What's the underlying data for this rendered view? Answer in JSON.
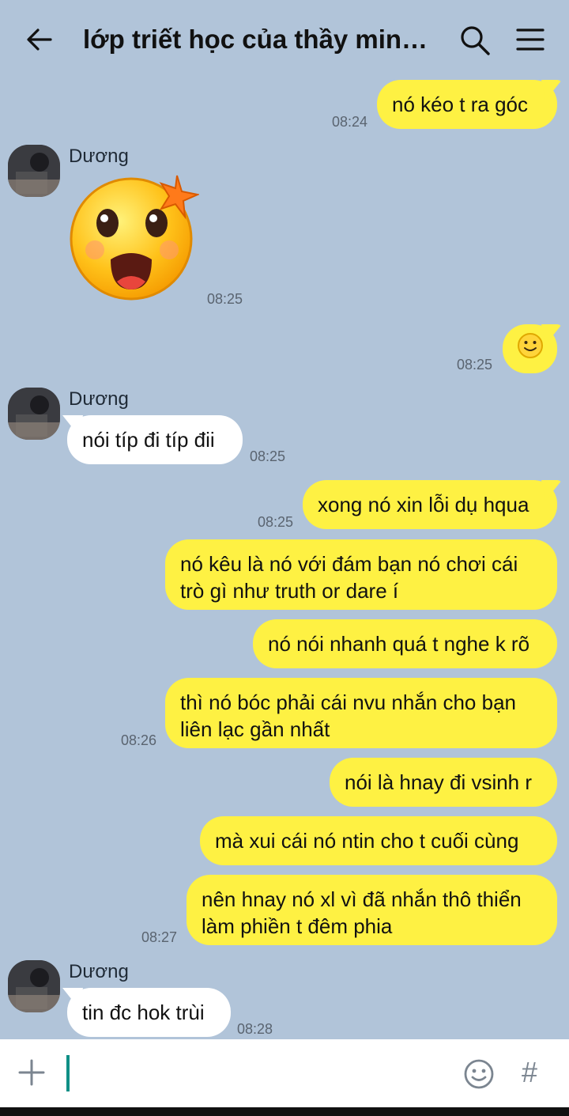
{
  "header": {
    "title": "lớp triết học của thầy min…",
    "back_icon": "back-arrow-icon",
    "search_icon": "search-icon",
    "menu_icon": "hamburger-menu-icon"
  },
  "sender_name": "Dương",
  "messages": [
    {
      "side": "me",
      "text": "nó kéo t ra góc",
      "time": "08:24"
    },
    {
      "side": "them",
      "kind": "sticker",
      "sticker": "surprised-emoji-sticker",
      "time": "08:25"
    },
    {
      "side": "me",
      "kind": "emoji",
      "emoji": "🙂",
      "time": "08:25"
    },
    {
      "side": "them",
      "text": "nói típ đi típ đii",
      "time": "08:25"
    },
    {
      "side": "me",
      "text": "xong nó xin lỗi dụ hqua",
      "time": "08:25"
    },
    {
      "side": "me",
      "text": "nó kêu là nó với đám bạn nó chơi cái trò gì như truth or dare í"
    },
    {
      "side": "me",
      "text": "nó nói nhanh quá t nghe k rõ"
    },
    {
      "side": "me",
      "text": "thì nó bóc phải cái nvu nhắn cho bạn liên lạc gần nhất",
      "time": "08:26"
    },
    {
      "side": "me",
      "text": "nói là hnay đi vsinh r"
    },
    {
      "side": "me",
      "text": "mà xui cái nó ntin cho t cuối cùng"
    },
    {
      "side": "me",
      "text": "nên hnay nó xl vì đã nhắn thô thiển làm phiền t đêm phia",
      "time": "08:27"
    },
    {
      "side": "them",
      "text": "tin đc hok trùi",
      "time": "08:28"
    }
  ],
  "composer": {
    "plus_icon": "plus-icon",
    "emoji_icon": "emoji-icon",
    "hash_label": "#"
  },
  "colors": {
    "background": "#b1c4d9",
    "my_bubble": "#fef143",
    "their_bubble": "#ffffff",
    "caret": "#0f8f86"
  }
}
